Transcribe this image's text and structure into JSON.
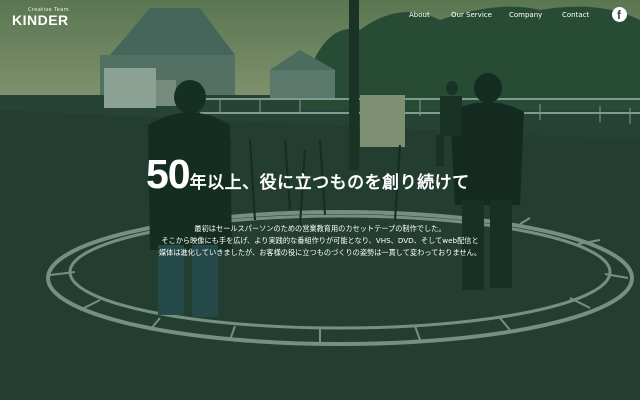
{
  "header": {
    "logo_tagline": "Creative Team",
    "logo_name": "KINDER",
    "nav": [
      {
        "label": "About"
      },
      {
        "label": "Our Service"
      },
      {
        "label": "Company"
      },
      {
        "label": "Contact"
      }
    ],
    "social_icon": "facebook-icon",
    "social_glyph": "f"
  },
  "hero": {
    "headline_number": "50",
    "headline_text": "年以上、役に立つものを創り続けて",
    "body_lines": [
      "最初はセールスパーソンのための営業教育用のカセットテープの制作でした。",
      "そこから映像にも手を広げ、より実践的な番組作りが可能となり、VHS、DVD、そしてweb配信と",
      "媒体は進化していきましたが、お客様の役に立つものづくりの姿勢は一貫して変わっておりません。"
    ]
  },
  "colors": {
    "overlay": "#184630",
    "text": "#ffffff"
  }
}
